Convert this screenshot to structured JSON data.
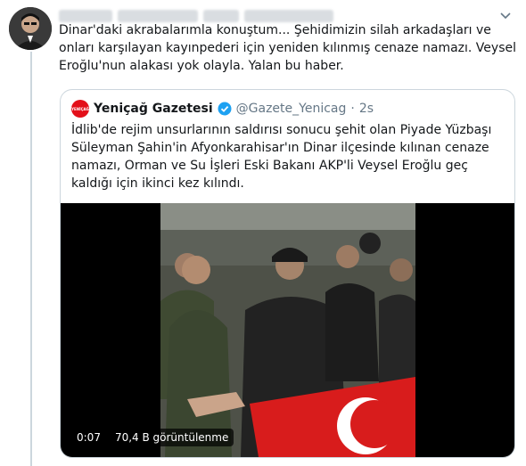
{
  "tweet": {
    "text": "Dinar'daki akrabalarımla konuştum... Şehidimizin silah arkadaşları ve onları karşılayan kayınpederi için yeniden kılınmış cenaze namazı. Veysel Eroğlu'nun alakası yok olayla. Yalan bu haber."
  },
  "quote": {
    "name": "Yeniçağ Gazetesi",
    "avatar_text": "YENİÇAĞ",
    "handle": "@Gazete_Yenicag",
    "separator": "·",
    "time": "2s",
    "text": "İdlib'de rejim unsurlarının saldırısı sonucu şehit olan Piyade Yüzbaşı Süleyman Şahin'in Afyonkarahisar'ın Dinar ilçesinde kılınan cenaze namazı, Orman ve Su İşleri Eski Bakanı AKP'li Veysel Eroğlu geç kaldığı için ikinci kez kılındı."
  },
  "video": {
    "duration": "0:07",
    "views": "70,4 B görüntülenme"
  },
  "colors": {
    "accent": "#1da1f2",
    "brand_red": "#e3101a",
    "border": "#ccd6dd",
    "muted": "#657786"
  }
}
